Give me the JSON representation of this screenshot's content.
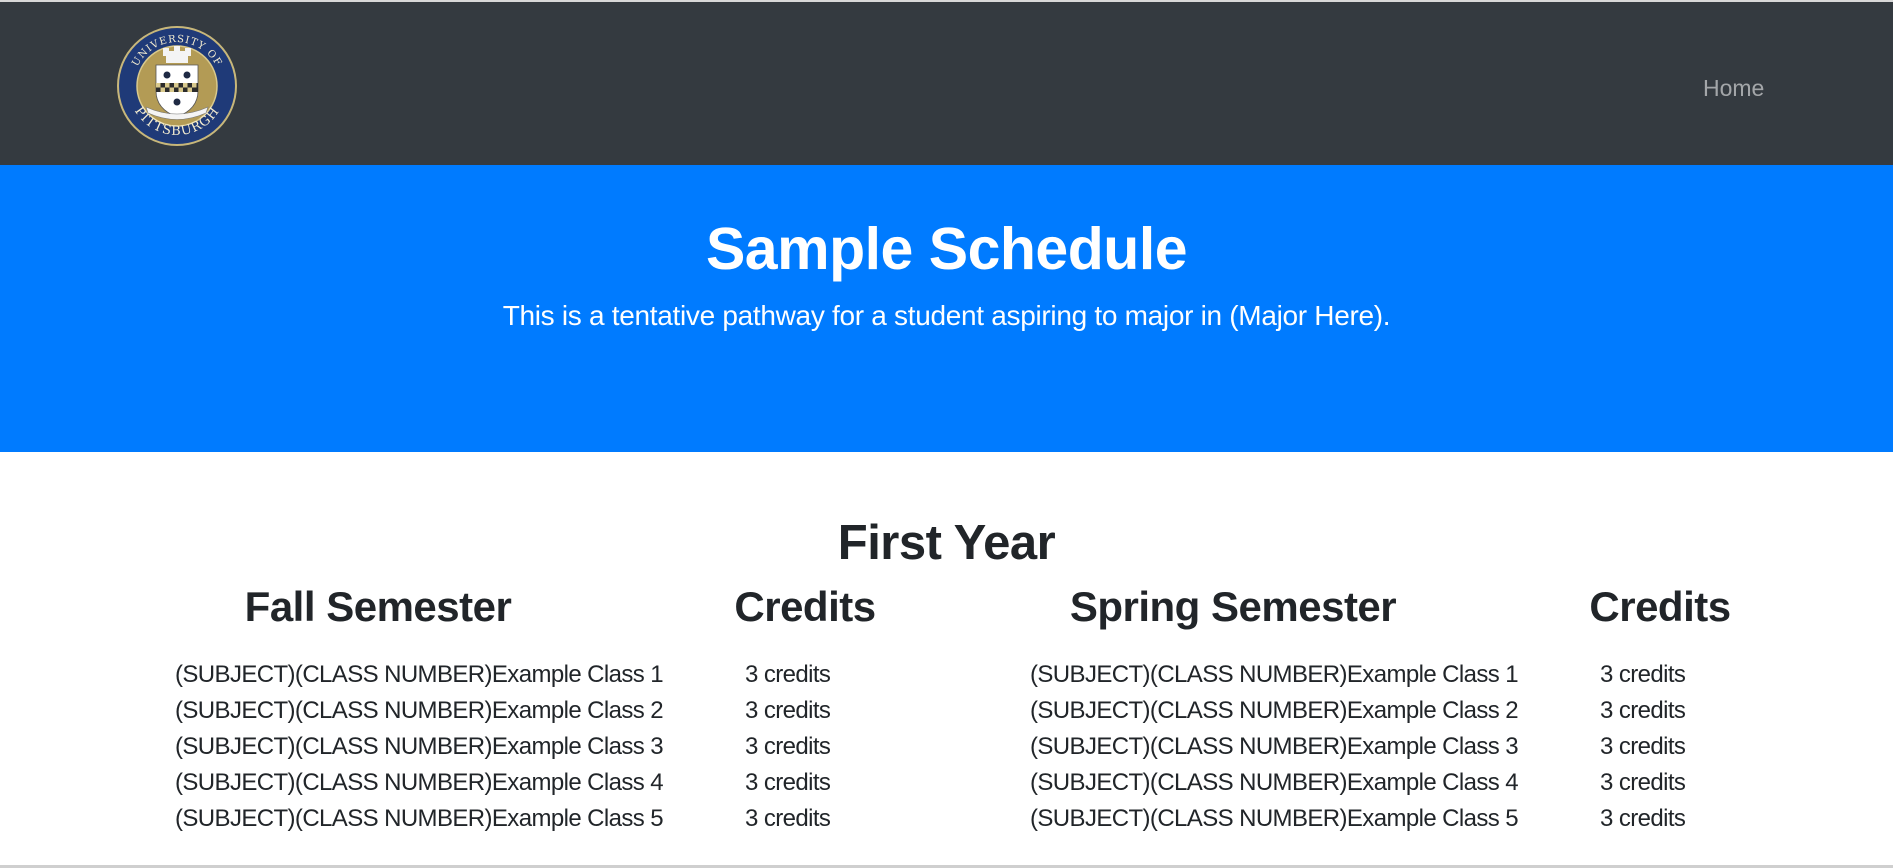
{
  "navbar": {
    "logo_alt": "University of Pittsburgh seal",
    "logo_icon": "university-seal-icon",
    "home_label": "Home",
    "bg_color": "#343a40"
  },
  "hero": {
    "title": "Sample Schedule",
    "subtitle": "This is a tentative pathway for a student aspiring to major in (Major Here).",
    "bg_color": "#007bff"
  },
  "schedule": {
    "year_title": "First Year",
    "headers": {
      "fall": "Fall Semester",
      "fall_credits": "Credits",
      "spring": "Spring Semester",
      "spring_credits": "Credits"
    },
    "fall": [
      {
        "class": "(SUBJECT)(CLASS NUMBER)Example Class 1",
        "credits": "3 credits"
      },
      {
        "class": "(SUBJECT)(CLASS NUMBER)Example Class 2",
        "credits": "3 credits"
      },
      {
        "class": "(SUBJECT)(CLASS NUMBER)Example Class 3",
        "credits": "3 credits"
      },
      {
        "class": "(SUBJECT)(CLASS NUMBER)Example Class 4",
        "credits": "3 credits"
      },
      {
        "class": "(SUBJECT)(CLASS NUMBER)Example Class 5",
        "credits": "3 credits"
      }
    ],
    "spring": [
      {
        "class": "(SUBJECT)(CLASS NUMBER)Example Class 1",
        "credits": "3 credits"
      },
      {
        "class": "(SUBJECT)(CLASS NUMBER)Example Class 2",
        "credits": "3 credits"
      },
      {
        "class": "(SUBJECT)(CLASS NUMBER)Example Class 3",
        "credits": "3 credits"
      },
      {
        "class": "(SUBJECT)(CLASS NUMBER)Example Class 4",
        "credits": "3 credits"
      },
      {
        "class": "(SUBJECT)(CLASS NUMBER)Example Class 5",
        "credits": "3 credits"
      }
    ]
  }
}
